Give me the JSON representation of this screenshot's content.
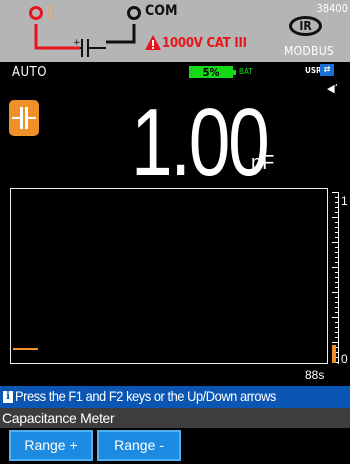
{
  "header": {
    "red_terminal_label": "||",
    "com_label": "COM",
    "rating": "1000V CAT III",
    "model_number": "38400",
    "ir_label": "IR",
    "protocol": "MODBUS"
  },
  "status": {
    "range_mode": "AUTO",
    "battery_percent": "5%",
    "battery_level": 0.05,
    "battery_label": "BAT",
    "usr_label": "USR",
    "usb_icon": "usb-icon",
    "sound_icon": "sound-off-icon"
  },
  "reading": {
    "function_icon": "capacitor-icon",
    "value": "1.00",
    "unit": "nF"
  },
  "graph": {
    "scale_max": "1",
    "scale_min": "0",
    "time_window": "88s"
  },
  "info": {
    "icon": "info-icon",
    "text": "Press the F1 and F2 keys or the Up/Down arrows"
  },
  "meter_name": "Capacitance Meter",
  "softkeys": {
    "f1_label": "Range +",
    "f2_label": "Range -"
  },
  "colors": {
    "header_bg": "#b5b5b5",
    "accent_orange": "#f0902b",
    "warning_red": "#e8141b",
    "battery_green": "#15d915",
    "info_blue": "#0b55b3",
    "softkey_blue": "#1c8ae0"
  }
}
